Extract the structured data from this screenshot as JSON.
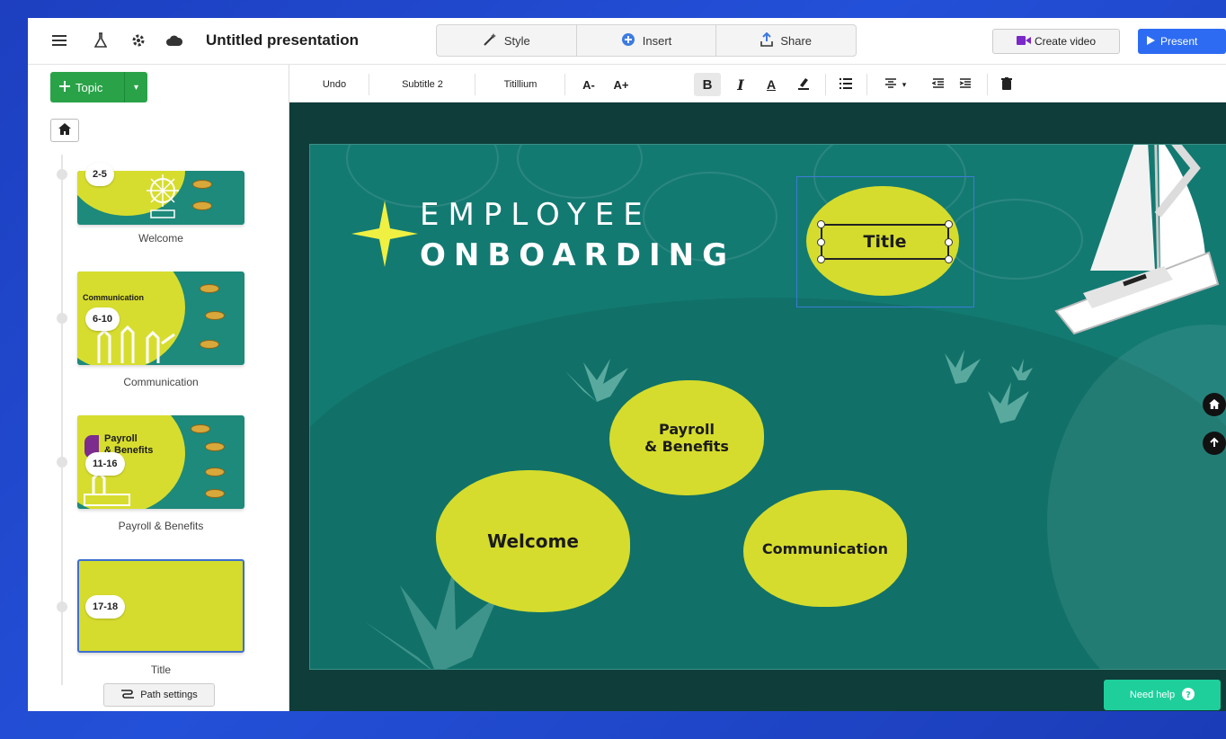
{
  "topbar": {
    "title": "Untitled presentation",
    "style_label": "Style",
    "insert_label": "Insert",
    "share_label": "Share",
    "create_video_label": "Create video",
    "present_label": "Present"
  },
  "sidebar": {
    "topic_label": "Topic",
    "path_settings_label": "Path settings",
    "items": [
      {
        "range": "2-5",
        "label": "Welcome"
      },
      {
        "range": "6-10",
        "label": "Communication",
        "thumb_text": "Communication"
      },
      {
        "range": "11-16",
        "label": "Payroll & Benefits",
        "thumb_text": "Payroll\n& Benefits"
      },
      {
        "range": "17-18",
        "label": "Title"
      }
    ]
  },
  "format_bar": {
    "undo": "Undo",
    "text_style": "Subtitle 2",
    "font": "Titillium",
    "decrease": "A-",
    "increase": "A+",
    "bold": "B",
    "italic": "I",
    "color": "A"
  },
  "slide": {
    "heading_line1": "EMPLOYEE",
    "heading_line2": "ONBOARDING",
    "title_bubble": "Title",
    "payroll_line1": "Payroll",
    "payroll_line2": "& Benefits",
    "welcome": "Welcome",
    "communication": "Communication"
  },
  "help_label": "Need help",
  "colors": {
    "background": "#1d3fc0",
    "canvas": "#0e3d3a",
    "slide": "#137a72",
    "bubble": "#d5dc2d",
    "topic_button": "#2aa348",
    "present_button": "#2d6bf2",
    "help_button": "#1ecf9c"
  }
}
